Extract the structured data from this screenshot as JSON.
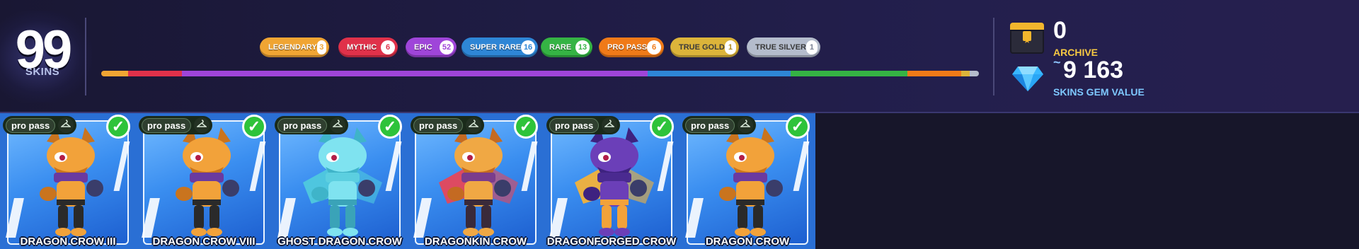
{
  "summary": {
    "skins_count": "99",
    "skins_label": "SKINS"
  },
  "rarities": [
    {
      "label": "LEGENDARY",
      "count": "3",
      "color": "#f0a533",
      "bar_share": 3
    },
    {
      "label": "MYTHIC",
      "count": "6",
      "color": "#e0314a",
      "bar_share": 6
    },
    {
      "label": "EPIC",
      "count": "52",
      "color": "#9f45d9",
      "bar_share": 52
    },
    {
      "label": "SUPER RARE",
      "count": "16",
      "color": "#2e86d6",
      "bar_share": 16
    },
    {
      "label": "RARE",
      "count": "13",
      "color": "#35b344",
      "bar_share": 13
    },
    {
      "label": "PRO PASS",
      "count": "6",
      "color": "#f07a18",
      "bar_share": 6
    },
    {
      "label": "TRUE GOLD",
      "count": "1",
      "color": "#dcb43a",
      "bar_share": 1
    },
    {
      "label": "TRUE SILVER",
      "count": "1",
      "color": "#b4bccc",
      "bar_share": 1
    }
  ],
  "archive": {
    "value": "0",
    "label": "ARCHIVE"
  },
  "gem_value": {
    "approx": "~",
    "value": "9 163",
    "label": "SKINS GEM VALUE"
  },
  "cards": [
    {
      "name": "DRAGON CROW III",
      "tag": "pro pass",
      "variant": "orange"
    },
    {
      "name": "DRAGON CROW VIII",
      "tag": "pro pass",
      "variant": "orange"
    },
    {
      "name": "GHOST DRAGON CROW",
      "tag": "pro pass",
      "variant": "ghost"
    },
    {
      "name": "DRAGONKIN CROW",
      "tag": "pro pass",
      "variant": "kin"
    },
    {
      "name": "DRAGONFORGED CROW",
      "tag": "pro pass",
      "variant": "forged"
    },
    {
      "name": "DRAGON CROW",
      "tag": "pro pass",
      "variant": "orange"
    }
  ],
  "icons": {
    "skin_tag": "hanger-icon",
    "owned": "checkmark-icon",
    "archive": "chest-icon",
    "gems": "gem-icon"
  }
}
